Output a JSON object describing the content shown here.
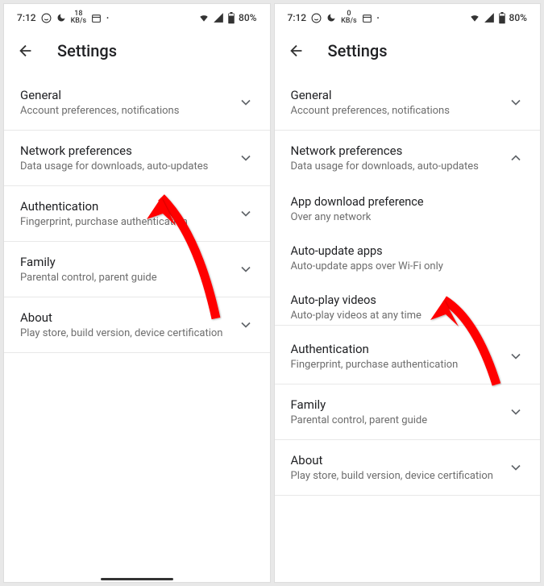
{
  "status": {
    "time": "7:12",
    "kbs_left": "18",
    "kbs_right": "0",
    "kbs_label": "KB/s",
    "battery": "80%"
  },
  "header": {
    "title": "Settings"
  },
  "left": {
    "sections": [
      {
        "title": "General",
        "sub": "Account preferences, notifications"
      },
      {
        "title": "Network preferences",
        "sub": "Data usage for downloads, auto-updates"
      },
      {
        "title": "Authentication",
        "sub": "Fingerprint, purchase authentication"
      },
      {
        "title": "Family",
        "sub": "Parental control, parent guide"
      },
      {
        "title": "About",
        "sub": "Play store, build version, device certification"
      }
    ]
  },
  "right": {
    "sections": [
      {
        "title": "General",
        "sub": "Account preferences, notifications"
      },
      {
        "title": "Network preferences",
        "sub": "Data usage for downloads, auto-updates"
      }
    ],
    "expanded": [
      {
        "title": "App download preference",
        "sub": "Over any network"
      },
      {
        "title": "Auto-update apps",
        "sub": "Auto-update apps over Wi-Fi only"
      },
      {
        "title": "Auto-play videos",
        "sub": "Auto-play videos at any time"
      }
    ],
    "after": [
      {
        "title": "Authentication",
        "sub": "Fingerprint, purchase authentication"
      },
      {
        "title": "Family",
        "sub": "Parental control, parent guide"
      },
      {
        "title": "About",
        "sub": "Play store, build version, device certification"
      }
    ]
  }
}
